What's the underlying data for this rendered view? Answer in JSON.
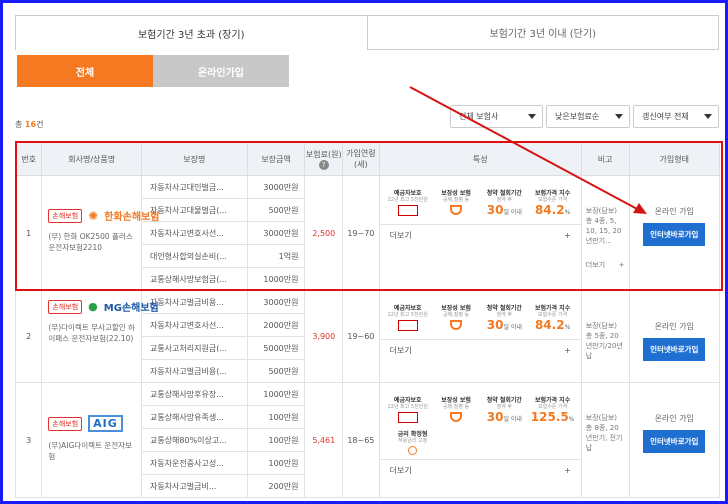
{
  "tabs": {
    "long": "보험기간 3년 초과 (장기)",
    "short": "보험기간 3년 이내 (단기)"
  },
  "subtabs": {
    "all": "전체",
    "online": "온라인가입"
  },
  "count": {
    "prefix": "총",
    "num": "16",
    "suffix": "건"
  },
  "filters": {
    "company": "전체 보험사",
    "sort": "낮은보험료순",
    "renew": "갱신여부 전체"
  },
  "headers": {
    "no": "번호",
    "company": "회사명/상품명",
    "coverage": "보장명",
    "amount": "보장금액",
    "premium": "보험료(원)",
    "age": "가입연령(세)",
    "feature": "특성",
    "note": "비고",
    "join": "가입형태"
  },
  "features": {
    "deposit_t": "예금자보호",
    "deposit_s": "22년 최고 5천만원",
    "guar_t": "보장성 보험",
    "guar_s": "공제,질병 등",
    "cool_t": "청약 철회기간",
    "cool_s": "청약 후",
    "cool_v": "30",
    "cool_u": "일 이내",
    "idx_t": "보험가격 지수",
    "idx_s": "보험수준 가격",
    "rate_t": "금리 확정형",
    "rate_s": "적용금리 고정"
  },
  "more": "더보기",
  "rows": [
    {
      "no": "1",
      "badge": "손해보험",
      "logo": "한화손해보험",
      "product": "(무) 한화 OK2500 플러스 운전자보험2210",
      "coverages": [
        [
          "자동차사고대인벌금...",
          "3000만원"
        ],
        [
          "자동차사고대물벌금(...",
          "500만원"
        ],
        [
          "자동차사고변호사선...",
          "3000만원"
        ],
        [
          "대인형사합의실손비(...",
          "1억원"
        ],
        [
          "교통상해사망보험금(...",
          "1000만원"
        ]
      ],
      "premium": "2,500",
      "age": "19~70",
      "index": "84.2",
      "note": "보장(담보) 총 4종, 5, 10, 15, 20년만기...",
      "join_label": "온라인 가입",
      "join_btn": "인터넷바로가입"
    },
    {
      "no": "2",
      "badge": "손해보험",
      "logo": "MG손해보험",
      "logo_sub": "MG 손해보험",
      "product": "(무)다이렉트 무사고할인 하이패스 운전자보험(22.10)",
      "coverages": [
        [
          "자동차사고벌금비용...",
          "3000만원"
        ],
        [
          "자동차사고변호사선...",
          "2000만원"
        ],
        [
          "교통사고처리지원금(...",
          "5000만원"
        ],
        [
          "자동차사고벌금비용(...",
          "500만원"
        ]
      ],
      "premium": "3,900",
      "age": "19~60",
      "index": "84.2",
      "note": "보장(담보) 총 5종, 20년만기/20년납",
      "join_label": "온라인 가입",
      "join_btn": "인터넷바로가입"
    },
    {
      "no": "3",
      "badge": "손해보험",
      "logo": "AIG",
      "product": "(무)AIG다이렉트 운전자보험",
      "coverages": [
        [
          "교통상해사망후유장...",
          "1000만원"
        ],
        [
          "교통상해사망유족생...",
          "100만원"
        ],
        [
          "교통상해80%이상고...",
          "100만원"
        ],
        [
          "자동차운전중사고성...",
          "100만원"
        ],
        [
          "자동차사고벌금비...",
          "200만원"
        ]
      ],
      "premium": "5,461",
      "age": "18~65",
      "index": "125.5",
      "note": "보장(담보) 총 8종, 20년만기, 전기납",
      "join_label": "온라인 가입",
      "join_btn": "인터넷바로가입"
    }
  ]
}
